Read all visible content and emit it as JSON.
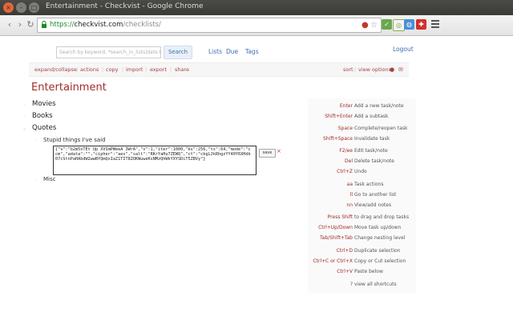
{
  "browser": {
    "title": "Entertainment - Checkvist - Google Chrome",
    "url_protocol": "https://",
    "url_host": "checkvist.com",
    "url_path": "/checklists/"
  },
  "header": {
    "search_placeholder": "Search by keyword, *search_in_lists|date:test",
    "search_button": "Search",
    "nav_lists": "Lists",
    "nav_due": "Due",
    "nav_tags": "Tags",
    "logout": "Logout"
  },
  "actions": {
    "expand_collapse": "expand/collapse",
    "actions": "actions",
    "copy": "copy",
    "import": "import",
    "export": "export",
    "share": "share",
    "sort": "sort",
    "view_options": "view options"
  },
  "list": {
    "title": "Entertainment",
    "items": [
      {
        "text": "Movies"
      },
      {
        "text": "Books"
      },
      {
        "text": "Quotes"
      }
    ],
    "subitems": [
      {
        "text": "Stupid things I've said"
      },
      {
        "text": "Misc"
      }
    ],
    "editor_text": "{\"v\":\"b2m5xTEt Up XVSmPWeeA 3WrA\",\"v\":1,\"iter\":1000,\"ks\":256,\"ts\":64,\"mode\":\"ccm\",\"adata\":\"\",\"cipher\":\"aes\",\"salt\":\"RKrYaHu7ZEWQ\",\"ct\":\"ckgLJkRhgzYY40Y6XHdk07cStnPaHAbdW2wwBYQmQxIaZ1TIT8ZOKWuweKsNMzQhWkYXYSDiT5ZBVy\"}",
    "save_label": "save",
    "cancel_glyph": "×"
  },
  "shortcuts": [
    {
      "key": "Enter",
      "desc": "Add a new task/note"
    },
    {
      "key": "Shift+Enter",
      "desc": "Add a subtask"
    },
    {
      "key": "Space",
      "desc": "Complete/reopen task"
    },
    {
      "key": "Shift+Space",
      "desc": "Invalidate task"
    },
    {
      "key": "F2/ee",
      "desc": "Edit task/note"
    },
    {
      "key": "Del",
      "desc": "Delete task/note"
    },
    {
      "key": "Ctrl+Z",
      "desc": "Undo"
    },
    {
      "key": "aa",
      "desc": "Task actions"
    },
    {
      "key": "ll",
      "desc": "Go to another list"
    },
    {
      "key": "nn",
      "desc": "View/add notes"
    },
    {
      "key": "Press Shift",
      "desc": "to drag and drop tasks"
    },
    {
      "key": "Ctrl+Up/Down",
      "desc": "Move task up/down"
    },
    {
      "key": "Tab/Shift+Tab",
      "desc": "Change nesting level"
    },
    {
      "key": "Ctrl+D",
      "desc": "Duplicate selection"
    },
    {
      "key": "Ctrl+C or Ctrl+X",
      "desc": "Copy or Cut selection"
    },
    {
      "key": "Ctrl+V",
      "desc": "Paste below"
    },
    {
      "key": "?",
      "desc": "view all shortcuts"
    }
  ]
}
